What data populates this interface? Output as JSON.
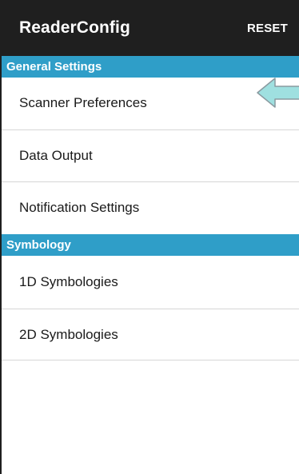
{
  "appbar": {
    "title": "ReaderConfig",
    "reset_label": "RESET"
  },
  "sections": [
    {
      "header": "General Settings",
      "items": [
        {
          "label": "Scanner Preferences"
        },
        {
          "label": "Data Output"
        },
        {
          "label": "Notification Settings"
        }
      ]
    },
    {
      "header": "Symbology",
      "items": [
        {
          "label": "1D Symbologies"
        },
        {
          "label": "2D Symbologies"
        }
      ]
    }
  ],
  "colors": {
    "appbar_bg": "#1f1f1f",
    "section_header_bg": "#2f9ec8",
    "pointer_arrow_fill": "#9fe0e0"
  },
  "icons": {
    "pointer": "left-arrow-icon"
  }
}
